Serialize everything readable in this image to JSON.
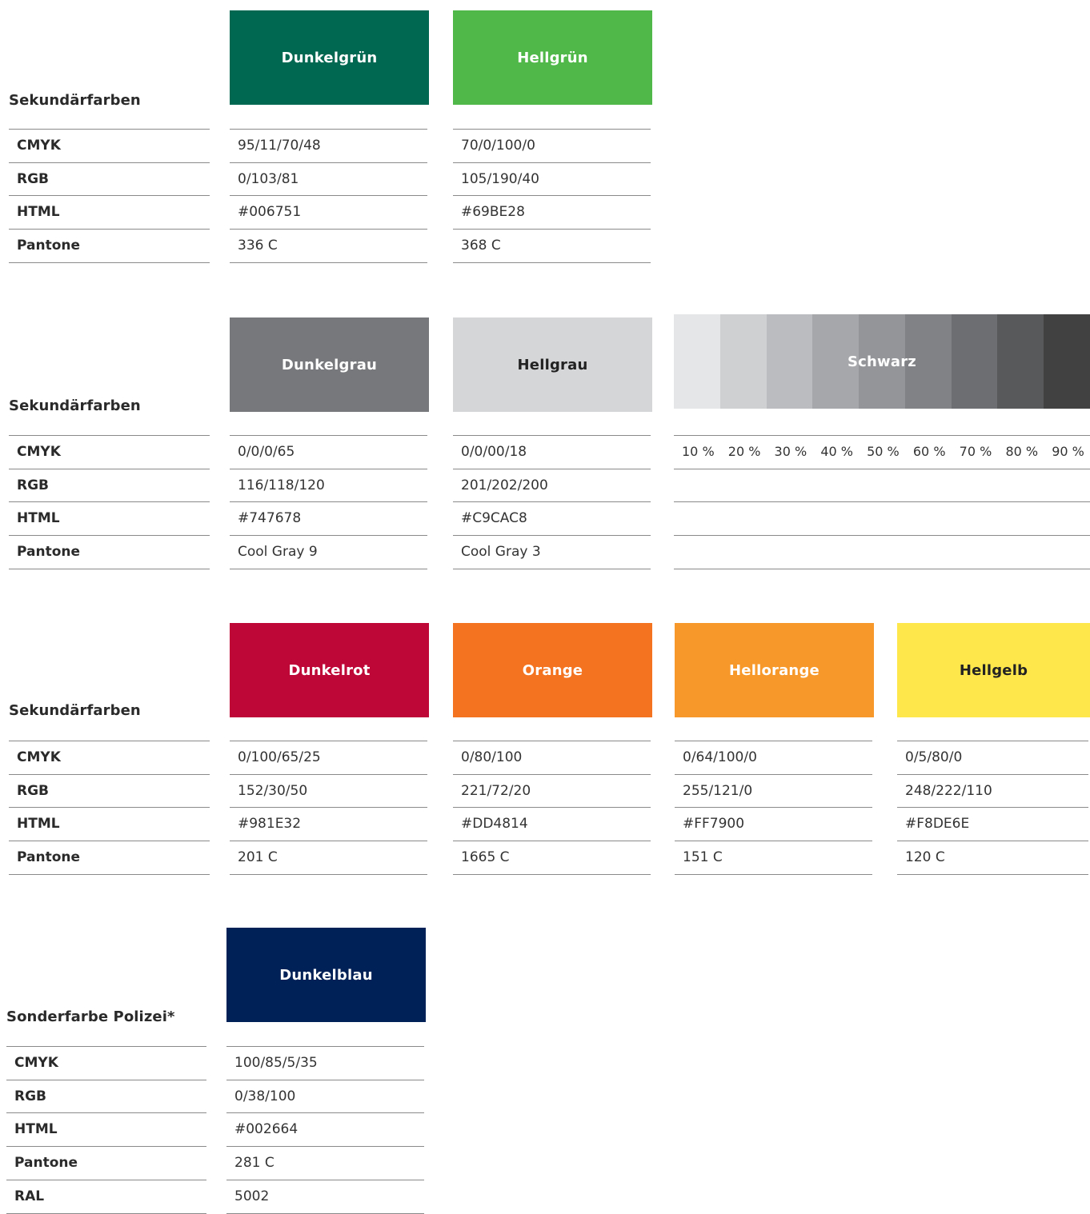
{
  "sections": [
    {
      "title": "Sekundärfarben",
      "labels": [
        "CMYK",
        "RGB",
        "HTML",
        "Pantone"
      ],
      "colors": [
        {
          "name": "Dunkelgrün",
          "swatch": "#006751",
          "text_color": "#ffffff",
          "values": [
            "95/11/70/48",
            "0/103/81",
            "#006751",
            "336 C"
          ]
        },
        {
          "name": "Hellgrün",
          "swatch": "#50B848",
          "text_color": "#ffffff",
          "values": [
            "70/0/100/0",
            "105/190/40",
            "#69BE28",
            "368 C"
          ]
        }
      ]
    },
    {
      "title": "Sekundärfarben",
      "labels": [
        "CMYK",
        "RGB",
        "HTML",
        "Pantone"
      ],
      "colors": [
        {
          "name": "Dunkelgrau",
          "swatch": "#77787B",
          "text_color": "#ffffff",
          "values": [
            "0/0/0/65",
            "116/118/120",
            "#747678",
            "Cool Gray 9"
          ]
        },
        {
          "name": "Hellgrau",
          "swatch": "#D5D6D8",
          "text_color": "#222222",
          "values": [
            "0/0/00/18",
            "201/202/200",
            "#C9CAC8",
            "Cool Gray 3"
          ]
        }
      ],
      "schwarz": {
        "name": "Schwarz",
        "text_color": "#ffffff",
        "tints": [
          {
            "label": "10 %",
            "color": "#E5E6E7"
          },
          {
            "label": "20 %",
            "color": "#CFD0D2"
          },
          {
            "label": "30 %",
            "color": "#BBBCBF"
          },
          {
            "label": "40 %",
            "color": "#A6A7AA"
          },
          {
            "label": "50 %",
            "color": "#939598"
          },
          {
            "label": "60 %",
            "color": "#808285"
          },
          {
            "label": "70 %",
            "color": "#6D6E71"
          },
          {
            "label": "80 %",
            "color": "#58595B"
          },
          {
            "label": "90 %",
            "color": "#414142"
          }
        ]
      }
    },
    {
      "title": "Sekundärfarben",
      "labels": [
        "CMYK",
        "RGB",
        "HTML",
        "Pantone"
      ],
      "colors": [
        {
          "name": "Dunkelrot",
          "swatch": "#BE0737",
          "text_color": "#ffffff",
          "values": [
            "0/100/65/25",
            "152/30/50",
            "#981E32",
            "201 C"
          ]
        },
        {
          "name": "Orange",
          "swatch": "#F37321",
          "text_color": "#ffffff",
          "values": [
            "0/80/100",
            "221/72/20",
            "#DD4814",
            "1665 C"
          ]
        },
        {
          "name": "Hellorange",
          "swatch": "#F6992A",
          "text_color": "#ffffff",
          "values": [
            "0/64/100/0",
            "255/121/0",
            "#FF7900",
            "151 C"
          ]
        },
        {
          "name": "Hellgelb",
          "swatch": "#FEE74B",
          "text_color": "#222222",
          "values": [
            "0/5/80/0",
            "248/222/110",
            "#F8DE6E",
            "120 C"
          ]
        }
      ]
    },
    {
      "title": "Sonderfarbe Polizei*",
      "labels": [
        "CMYK",
        "RGB",
        "HTML",
        "Pantone",
        "RAL"
      ],
      "colors": [
        {
          "name": "Dunkelblau",
          "swatch": "#002157",
          "text_color": "#ffffff",
          "values": [
            "100/85/5/35",
            "0/38/100",
            "#002664",
            "281 C",
            "5002"
          ]
        }
      ]
    }
  ]
}
